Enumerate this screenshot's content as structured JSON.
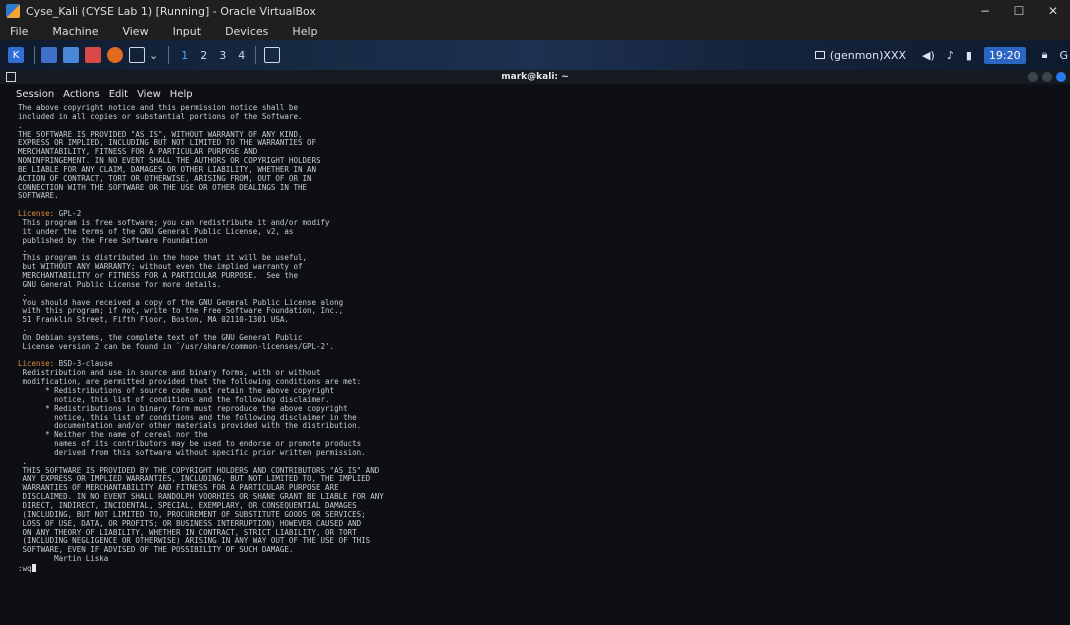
{
  "vbox": {
    "title": "Cyse_Kali (CYSE Lab 1) [Running] - Oracle VirtualBox",
    "menu": [
      "File",
      "Machine",
      "View",
      "Input",
      "Devices",
      "Help"
    ],
    "controls": {
      "minimize": "−",
      "maximize": "☐",
      "close": "✕"
    }
  },
  "panel": {
    "workspaces": [
      "1",
      "2",
      "3",
      "4"
    ],
    "active_workspace": "1",
    "genmon": "(genmon)XXX",
    "clock": "19:20",
    "icons": [
      "kali-menu-icon",
      "desktop-icon",
      "file-manager-icon",
      "text-editor-icon",
      "firefox-icon",
      "terminal-icon",
      "volume-icon",
      "notification-bell-icon",
      "battery-icon",
      "lock-icon"
    ]
  },
  "terminal": {
    "title": "mark@kali: ~",
    "menu": [
      "Session",
      "Actions",
      "Edit",
      "View",
      "Help"
    ],
    "lines": [
      {
        "text": "The above copyright notice and this permission notice shall be"
      },
      {
        "text": "included in all copies or substantial portions of the Software."
      },
      {
        "text": "."
      },
      {
        "text": "THE SOFTWARE IS PROVIDED \"AS IS\", WITHOUT WARRANTY OF ANY KIND,"
      },
      {
        "text": "EXPRESS OR IMPLIED, INCLUDING BUT NOT LIMITED TO THE WARRANTIES OF"
      },
      {
        "text": "MERCHANTABILITY, FITNESS FOR A PARTICULAR PURPOSE AND"
      },
      {
        "text": "NONINFRINGEMENT. IN NO EVENT SHALL THE AUTHORS OR COPYRIGHT HOLDERS"
      },
      {
        "text": "BE LIABLE FOR ANY CLAIM, DAMAGES OR OTHER LIABILITY, WHETHER IN AN"
      },
      {
        "text": "ACTION OF CONTRACT, TORT OR OTHERWISE, ARISING FROM, OUT OF OR IN"
      },
      {
        "text": "CONNECTION WITH THE SOFTWARE OR THE USE OR OTHER DEALINGS IN THE"
      },
      {
        "text": "SOFTWARE."
      },
      {
        "text": ""
      },
      {
        "key": "License:",
        "text": " GPL-2"
      },
      {
        "text": " This program is free software; you can redistribute it and/or modify"
      },
      {
        "text": " it under the terms of the GNU General Public License, v2, as"
      },
      {
        "text": " published by the Free Software Foundation"
      },
      {
        "text": " ."
      },
      {
        "text": " This program is distributed in the hope that it will be useful,"
      },
      {
        "text": " but WITHOUT ANY WARRANTY; without even the implied warranty of"
      },
      {
        "text": " MERCHANTABILITY or FITNESS FOR A PARTICULAR PURPOSE.  See the"
      },
      {
        "text": " GNU General Public License for more details."
      },
      {
        "text": " ."
      },
      {
        "text": " You should have received a copy of the GNU General Public License along"
      },
      {
        "text": " with this program; if not, write to the Free Software Foundation, Inc.,"
      },
      {
        "text": " 51 Franklin Street, Fifth Floor, Boston, MA 02110-1301 USA."
      },
      {
        "text": " ."
      },
      {
        "text": " On Debian systems, the complete text of the GNU General Public"
      },
      {
        "text": " License version 2 can be found in `/usr/share/common-licenses/GPL-2'."
      },
      {
        "text": ""
      },
      {
        "key": "License:",
        "text": " BSD-3-clause"
      },
      {
        "text": " Redistribution and use in source and binary forms, with or without"
      },
      {
        "text": " modification, are permitted provided that the following conditions are met:"
      },
      {
        "text": "      * Redistributions of source code must retain the above copyright"
      },
      {
        "text": "        notice, this list of conditions and the following disclaimer."
      },
      {
        "text": "      * Redistributions in binary form must reproduce the above copyright"
      },
      {
        "text": "        notice, this list of conditions and the following disclaimer in the"
      },
      {
        "text": "        documentation and/or other materials provided with the distribution."
      },
      {
        "text": "      * Neither the name of cereal nor the"
      },
      {
        "text": "        names of its contributors may be used to endorse or promote products"
      },
      {
        "text": "        derived from this software without specific prior written permission."
      },
      {
        "text": " ."
      },
      {
        "text": " THIS SOFTWARE IS PROVIDED BY THE COPYRIGHT HOLDERS AND CONTRIBUTORS \"AS IS\" AND"
      },
      {
        "text": " ANY EXPRESS OR IMPLIED WARRANTIES, INCLUDING, BUT NOT LIMITED TO, THE IMPLIED"
      },
      {
        "text": " WARRANTIES OF MERCHANTABILITY AND FITNESS FOR A PARTICULAR PURPOSE ARE"
      },
      {
        "text": " DISCLAIMED. IN NO EVENT SHALL RANDOLPH VOORHIES OR SHANE GRANT BE LIABLE FOR ANY"
      },
      {
        "text": " DIRECT, INDIRECT, INCIDENTAL, SPECIAL, EXEMPLARY, OR CONSEQUENTIAL DAMAGES"
      },
      {
        "text": " (INCLUDING, BUT NOT LIMITED TO, PROCUREMENT OF SUBSTITUTE GOODS OR SERVICES;"
      },
      {
        "text": " LOSS OF USE, DATA, OR PROFITS; OR BUSINESS INTERRUPTION) HOWEVER CAUSED AND"
      },
      {
        "text": " ON ANY THEORY OF LIABILITY, WHETHER IN CONTRACT, STRICT LIABILITY, OR TORT"
      },
      {
        "text": " (INCLUDING NEGLIGENCE OR OTHERWISE) ARISING IN ANY WAY OUT OF THE USE OF THIS"
      },
      {
        "text": " SOFTWARE, EVEN IF ADVISED OF THE POSSIBILITY OF SUCH DAMAGE."
      },
      {
        "text": "        Martin Liska"
      }
    ],
    "prompt": ":wq"
  },
  "colors": {
    "license_key": "#e0873c",
    "terminal_bg": "#0d0f14",
    "terminal_fg": "#c8cdd4",
    "accent": "#2d65c4"
  }
}
